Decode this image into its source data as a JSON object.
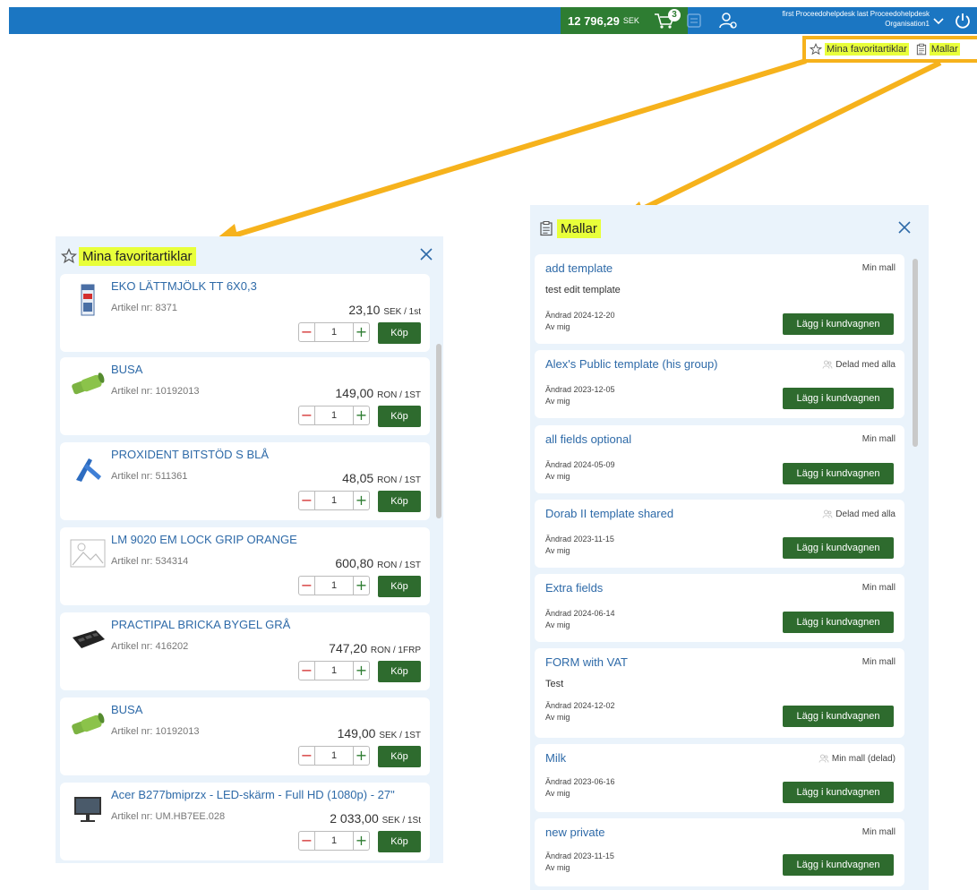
{
  "topbar": {
    "balance_amount": "12 796,29",
    "balance_currency": "SEK",
    "cart_count": "3",
    "user_line1": "first Proceedohelpdesk last Proceedohelpdesk",
    "user_line2": "Organisation1",
    "colors": {
      "bar": "#1b76c2",
      "balance": "#2e7d32"
    }
  },
  "quick_links": {
    "favorites": "Mina favoritartiklar",
    "templates": "Mallar"
  },
  "favorites_panel": {
    "title": "Mina favoritartiklar",
    "buy_label": "Köp",
    "items": [
      {
        "name": "EKO LÄTTMJÖLK TT 6X0,3",
        "article": "Artikel nr: 8371",
        "price": "23,10",
        "unit": "SEK / 1st",
        "qty": "1",
        "icon": "milk-carton-icon"
      },
      {
        "name": "BUSA",
        "article": "Artikel nr: 10192013",
        "price": "149,00",
        "unit": "RON / 1ST",
        "qty": "1",
        "icon": "hose-fitting-icon"
      },
      {
        "name": "PROXIDENT BITSTÖD S BLÅ",
        "article": "Artikel nr: 511361",
        "price": "48,05",
        "unit": "RON / 1ST",
        "qty": "1",
        "icon": "bite-block-icon"
      },
      {
        "name": "LM 9020 EM LOCK GRIP ORANGE",
        "article": "Artikel nr: 534314",
        "price": "600,80",
        "unit": "RON / 1ST",
        "qty": "1",
        "icon": "image-placeholder-icon"
      },
      {
        "name": "PRACTIPAL BRICKA BYGEL GRÅ",
        "article": "Artikel nr: 416202",
        "price": "747,20",
        "unit": "RON / 1FRP",
        "qty": "1",
        "icon": "tray-icon"
      },
      {
        "name": "BUSA",
        "article": "Artikel nr: 10192013",
        "price": "149,00",
        "unit": "SEK / 1ST",
        "qty": "1",
        "icon": "hose-fitting-icon"
      },
      {
        "name": "Acer B277bmiprzx - LED-skärm - Full HD (1080p) - 27\"",
        "article": "Artikel nr: UM.HB7EE.028",
        "price": "2 033,00",
        "unit": "SEK / 1St",
        "qty": "1",
        "icon": "monitor-icon"
      }
    ]
  },
  "templates_panel": {
    "title": "Mallar",
    "add_to_cart_label": "Lägg i kundvagnen",
    "items": [
      {
        "name": "add template",
        "type": "Min mall",
        "shared": false,
        "desc": "test edit template",
        "changed": "Ändrad 2024-12-20",
        "by": "Av mig"
      },
      {
        "name": "Alex's Public template (his group)",
        "type": "Delad med alla",
        "shared": true,
        "desc": "",
        "changed": "Ändrad 2023-12-05",
        "by": "Av mig"
      },
      {
        "name": "all fields optional",
        "type": "Min mall",
        "shared": false,
        "desc": "",
        "changed": "Ändrad 2024-05-09",
        "by": "Av mig"
      },
      {
        "name": "Dorab II template shared",
        "type": "Delad med alla",
        "shared": true,
        "desc": "",
        "changed": "Ändrad 2023-11-15",
        "by": "Av mig"
      },
      {
        "name": "Extra fields",
        "type": "Min mall",
        "shared": false,
        "desc": "",
        "changed": "Ändrad 2024-06-14",
        "by": "Av mig"
      },
      {
        "name": "FORM with VAT",
        "type": "Min mall",
        "shared": false,
        "desc": "Test",
        "changed": "Ändrad 2024-12-02",
        "by": "Av mig"
      },
      {
        "name": "Milk",
        "type": "Min mall (delad)",
        "shared": true,
        "desc": "",
        "changed": "Ändrad 2023-06-16",
        "by": "Av mig"
      },
      {
        "name": "new private",
        "type": "Min mall",
        "shared": false,
        "desc": "",
        "changed": "Ändrad 2023-11-15",
        "by": "Av mig"
      }
    ]
  },
  "colors": {
    "highlight": "#e8ff3a",
    "callout": "#f6b21c",
    "link": "#2e6aa8",
    "button": "#2e6b2e",
    "panel_bg": "#eaf3fb"
  }
}
